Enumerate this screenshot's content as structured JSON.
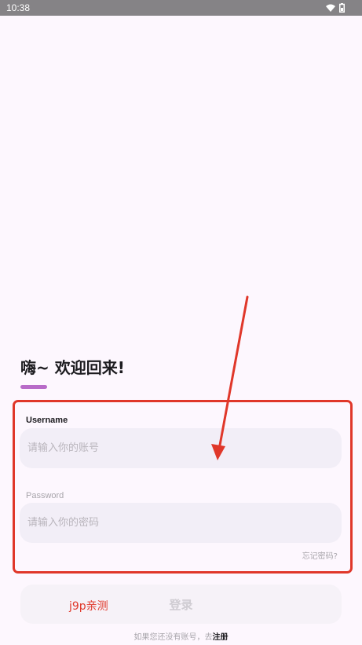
{
  "status_bar": {
    "time": "10:38",
    "icons": [
      "wifi-icon",
      "battery-icon"
    ]
  },
  "login": {
    "greeting": "嗨~ 欢迎回来!",
    "username": {
      "label": "Username",
      "placeholder": "请输入你的账号",
      "value": ""
    },
    "password": {
      "label": "Password",
      "placeholder": "请输入你的密码",
      "value": ""
    },
    "forgot_password": "忘记密码?",
    "login_button": "登录",
    "register_prompt": "如果您还没有账号，去",
    "register_link": "注册"
  },
  "annotation": {
    "watermark": "j9p亲测"
  },
  "colors": {
    "background": "#fdf7fe",
    "status_bar": "#858386",
    "accent_underline": "#b86bc8",
    "input_fill": "#f2eef7",
    "annotation_red": "#e0372a"
  }
}
